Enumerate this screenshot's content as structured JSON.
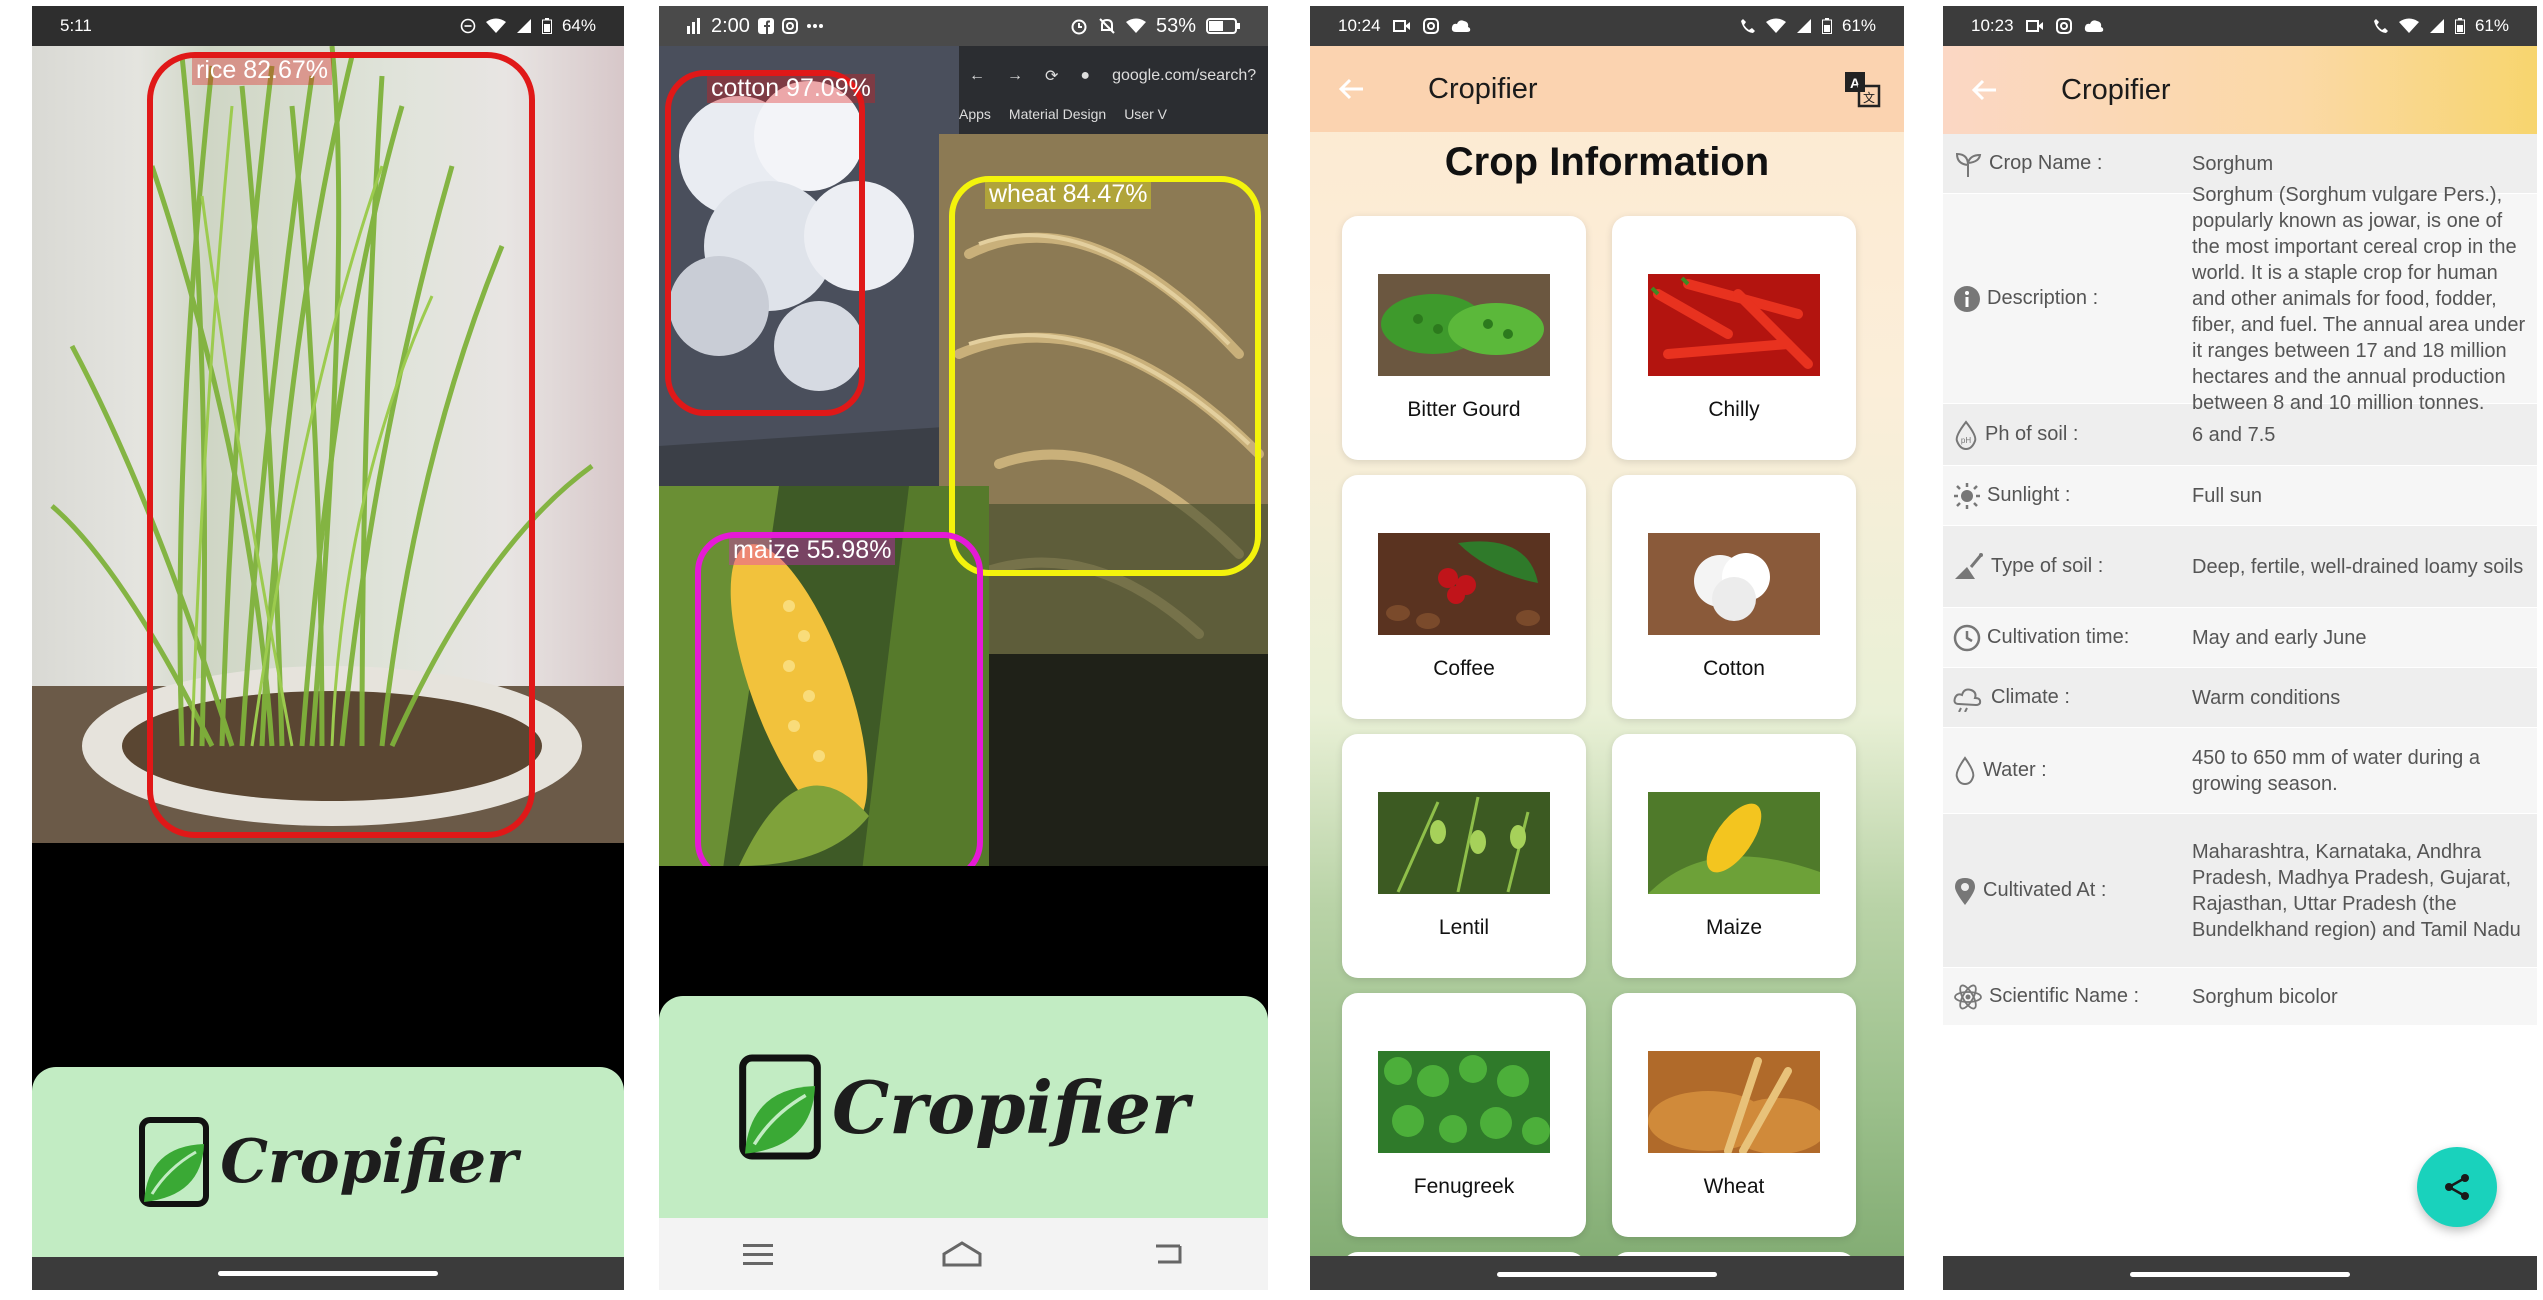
{
  "colors": {
    "rice_box": "#e01818",
    "cotton_box": "#e01818",
    "wheat_box": "#f3f30c",
    "maize_box": "#e51ad6",
    "logo_panel": "#c2ecc3",
    "fab": "#19d2bc"
  },
  "screen1": {
    "status": {
      "time": "5:11",
      "battery": "64%"
    },
    "detections": [
      {
        "label": "rice 82.67%"
      }
    ],
    "logo_text": "Cropifier"
  },
  "screen2": {
    "status": {
      "time": "2:00",
      "battery": "53%"
    },
    "browser": {
      "url": "google.com/search?",
      "bookmarks": [
        "Apps",
        "Material Design",
        "User V"
      ]
    },
    "detections": [
      {
        "label": "cotton 97.09%"
      },
      {
        "label": "wheat 84.47%"
      },
      {
        "label": "maize 55.98%"
      }
    ],
    "logo_text": "Cropifier",
    "nav": {
      "menu": "menu-icon",
      "home": "home-icon",
      "back": "back-icon"
    }
  },
  "screen3": {
    "status": {
      "time": "10:24",
      "battery": "61%"
    },
    "appbar_title": "Cropifier",
    "section_title": "Crop Information",
    "crops": [
      {
        "name": "Bitter Gourd",
        "icon": "bitter-gourd-image"
      },
      {
        "name": "Chilly",
        "icon": "chilly-image"
      },
      {
        "name": "Coffee",
        "icon": "coffee-image"
      },
      {
        "name": "Cotton",
        "icon": "cotton-image"
      },
      {
        "name": "Lentil",
        "icon": "lentil-image"
      },
      {
        "name": "Maize",
        "icon": "maize-image"
      },
      {
        "name": "Fenugreek",
        "icon": "fenugreek-image"
      },
      {
        "name": "Wheat",
        "icon": "wheat-image"
      }
    ]
  },
  "screen4": {
    "status": {
      "time": "10:23",
      "battery": "61%"
    },
    "appbar_title": "Cropifier",
    "rows": [
      {
        "key": "Crop Name :",
        "value": "Sorghum",
        "icon": "sprout-icon"
      },
      {
        "key": "Description :",
        "value": "Sorghum (Sorghum vulgare Pers.), popularly known as jowar, is one of the most important cereal crop in the world. It is a staple crop for human and other animals for food, fodder, fiber, and fuel. The annual area under it ranges between 17 and 18 million hectares and the annual production between 8 and 10 million tonnes.",
        "icon": "info-icon"
      },
      {
        "key": "Ph of soil :",
        "value": "6 and 7.5",
        "icon": "drop-ph-icon"
      },
      {
        "key": "Sunlight :",
        "value": "Full sun",
        "icon": "sun-icon"
      },
      {
        "key": "Type of soil :",
        "value": "Deep, fertile, well-drained loamy soils",
        "icon": "soil-icon"
      },
      {
        "key": "Cultivation time:",
        "value": "May and early June",
        "icon": "clock-icon"
      },
      {
        "key": "Climate :",
        "value": "Warm conditions",
        "icon": "climate-icon"
      },
      {
        "key": "Water :",
        "value": "450 to 650 mm of water during a growing season.",
        "icon": "water-icon"
      },
      {
        "key": "Cultivated At :",
        "value": "Maharashtra, Karnataka, Andhra Pradesh, Madhya Pradesh, Gujarat, Rajasthan, Uttar Pradesh (the Bundelkhand region) and Tamil Nadu",
        "icon": "location-icon"
      },
      {
        "key": "Scientific Name :",
        "value": "Sorghum bicolor",
        "icon": "atom-icon"
      }
    ],
    "fab_icon": "share-icon"
  }
}
